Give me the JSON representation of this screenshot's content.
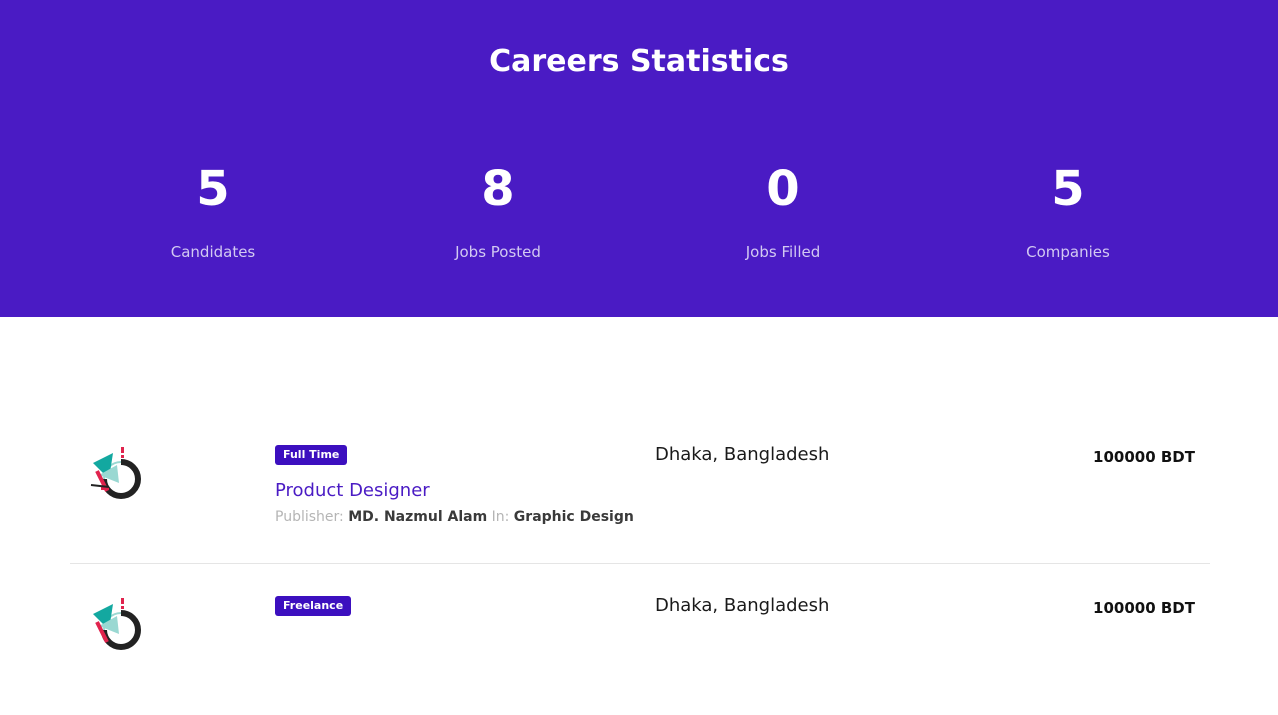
{
  "stats": {
    "title": "Careers Statistics",
    "items": [
      {
        "value": "5",
        "label": "Candidates"
      },
      {
        "value": "8",
        "label": "Jobs Posted"
      },
      {
        "value": "0",
        "label": "Jobs Filled"
      },
      {
        "value": "5",
        "label": "Companies"
      }
    ]
  },
  "jobs": [
    {
      "type": "Full Time",
      "title": "Product Designer",
      "publisher_label": "Publisher:",
      "publisher": "MD. Nazmul Alam",
      "in_label": "In:",
      "category": "Graphic Design",
      "location": "Dhaka, Bangladesh",
      "salary": "100000 BDT"
    },
    {
      "type": "Freelance",
      "location": "Dhaka, Bangladesh",
      "salary": "100000 BDT"
    }
  ],
  "colors": {
    "banner_bg": "#4a1bc4",
    "badge_bg": "#3c0fbf",
    "link": "#4a1bc4"
  },
  "icons": {
    "company_logo": "company-logo-icon"
  }
}
